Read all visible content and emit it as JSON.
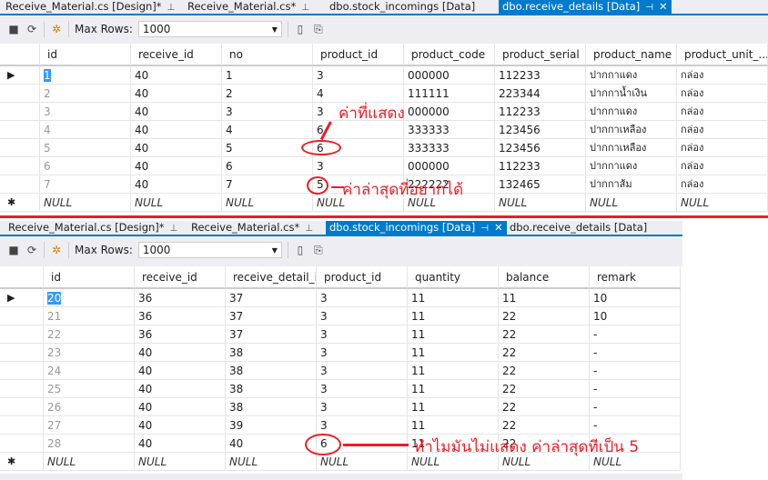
{
  "top": {
    "tabs": [
      {
        "label": "Receive_Material.cs [Design]*",
        "active": false
      },
      {
        "label": "Receive_Material.cs*",
        "active": false
      },
      {
        "label": "dbo.stock_incomings [Data]",
        "active": false
      },
      {
        "label": "dbo.receive_details [Data]",
        "active": true
      }
    ],
    "max_rows_label": "Max Rows:",
    "max_rows_value": "1000",
    "columns": [
      "id",
      "receive_id",
      "no",
      "product_id",
      "product_code",
      "product_serial",
      "product_name",
      "product_unit_..."
    ],
    "rows": [
      [
        "1",
        "40",
        "1",
        "3",
        "000000",
        "112233",
        "ปากกาแดง",
        "กล่อง"
      ],
      [
        "2",
        "40",
        "2",
        "4",
        "111111",
        "223344",
        "ปากกาน้ำเงิน",
        "กล่อง"
      ],
      [
        "3",
        "40",
        "3",
        "3",
        "000000",
        "112233",
        "ปากกาแดง",
        "กล่อง"
      ],
      [
        "4",
        "40",
        "4",
        "6",
        "333333",
        "123456",
        "ปากกาเหลือง",
        "กล่อง"
      ],
      [
        "5",
        "40",
        "5",
        "6",
        "333333",
        "123456",
        "ปากกาเหลือง",
        "กล่อง"
      ],
      [
        "6",
        "40",
        "6",
        "3",
        "000000",
        "112233",
        "ปากกาแดง",
        "กล่อง"
      ],
      [
        "7",
        "40",
        "7",
        "5",
        "222222",
        "132465",
        "ปากกาส้ม",
        "กล่อง"
      ]
    ],
    "null_row": [
      "NULL",
      "NULL",
      "NULL",
      "NULL",
      "NULL",
      "NULL",
      "NULL",
      "NULL"
    ]
  },
  "bottom": {
    "tabs": [
      {
        "label": "Receive_Material.cs [Design]*",
        "active": false
      },
      {
        "label": "Receive_Material.cs*",
        "active": false
      },
      {
        "label": "dbo.stock_incomings [Data]",
        "active": true
      },
      {
        "label": "dbo.receive_details [Data]",
        "active": false
      }
    ],
    "max_rows_label": "Max Rows:",
    "max_rows_value": "1000",
    "columns": [
      "id",
      "receive_id",
      "receive_detail_id",
      "product_id",
      "quantity",
      "balance",
      "remark"
    ],
    "rows": [
      [
        "20",
        "36",
        "37",
        "3",
        "11",
        "11",
        "10"
      ],
      [
        "21",
        "36",
        "37",
        "3",
        "11",
        "22",
        "10"
      ],
      [
        "22",
        "36",
        "37",
        "3",
        "11",
        "22",
        "-"
      ],
      [
        "23",
        "40",
        "38",
        "3",
        "11",
        "22",
        "-"
      ],
      [
        "24",
        "40",
        "38",
        "3",
        "11",
        "22",
        "-"
      ],
      [
        "25",
        "40",
        "38",
        "3",
        "11",
        "22",
        "-"
      ],
      [
        "26",
        "40",
        "38",
        "3",
        "11",
        "22",
        "-"
      ],
      [
        "27",
        "40",
        "39",
        "3",
        "11",
        "22",
        "-"
      ],
      [
        "28",
        "40",
        "40",
        "6",
        "11",
        "22",
        "-"
      ]
    ],
    "null_row": [
      "NULL",
      "NULL",
      "NULL",
      "NULL",
      "NULL",
      "NULL",
      "NULL"
    ]
  },
  "annotations": {
    "shown_value": "ค่าที่แสดง",
    "wanted_latest": "ค่าล่าสุดที่อยากได้",
    "question": "ทำไมมันไม่แสดง   ค่าล่าสุดทีเป็น   5"
  },
  "colors": {
    "accent": "#007acc",
    "annotation": "#ee1c24",
    "selection": "#3399ff"
  }
}
